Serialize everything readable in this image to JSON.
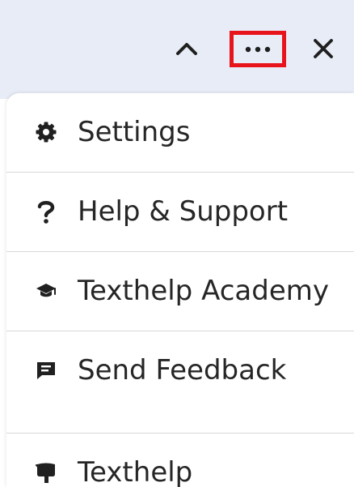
{
  "menu": {
    "items": [
      {
        "label": "Settings",
        "icon": "gear-icon"
      },
      {
        "label": "Help & Support",
        "icon": "question-icon"
      },
      {
        "label": "Texthelp Academy",
        "icon": "graduation-cap-icon"
      },
      {
        "label": "Send Feedback",
        "icon": "feedback-message-icon"
      },
      {
        "label": "Texthelp",
        "icon": "texthelp-logo-icon"
      }
    ]
  },
  "toolbar": {
    "icons": [
      "chevron-up-icon",
      "more-icon",
      "close-icon"
    ],
    "highlight_color": "#e8141b"
  },
  "colors": {
    "top_bar": "#e8ecf6",
    "text": "#262626",
    "divider": "#d8d8d8"
  }
}
